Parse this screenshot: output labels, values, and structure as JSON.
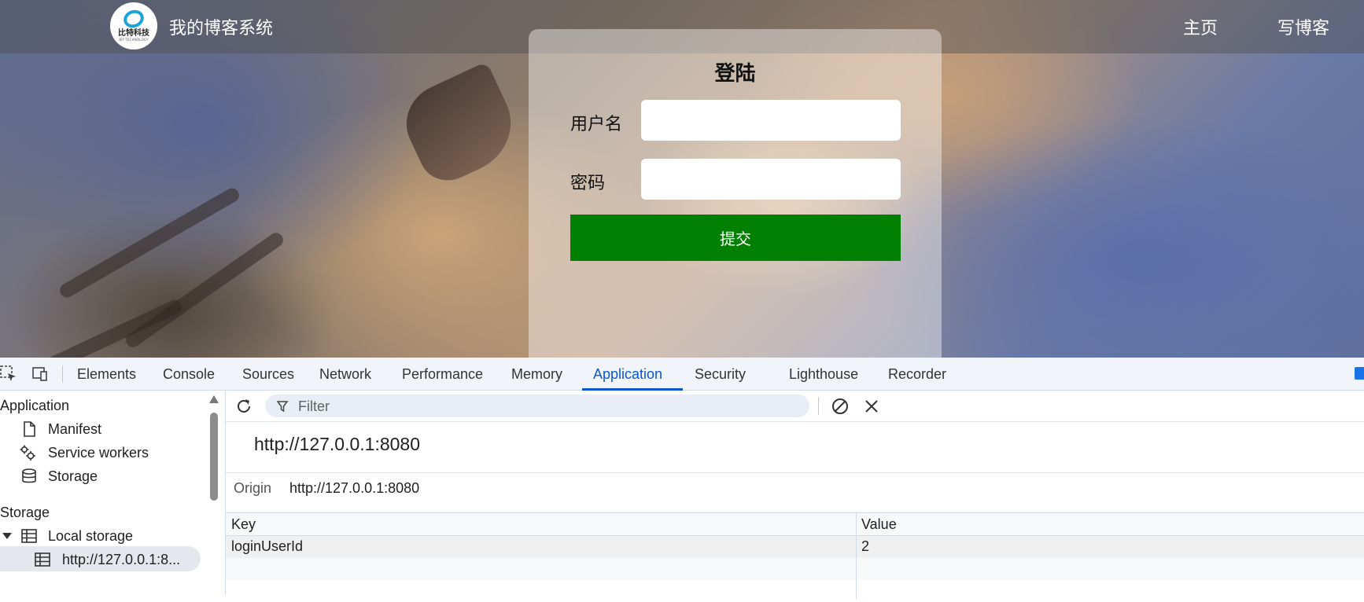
{
  "site": {
    "logo_text": "比特科技",
    "logo_sub": "BIT-TECHNOLOGY",
    "title": "我的博客系统",
    "nav": [
      {
        "label": "主页"
      },
      {
        "label": "写博客"
      }
    ]
  },
  "login": {
    "title": "登陆",
    "username_label": "用户名",
    "username_value": "",
    "password_label": "密码",
    "password_value": "",
    "submit_label": "提交",
    "submit_color": "#008000"
  },
  "devtools": {
    "tabs": [
      {
        "label": "Elements"
      },
      {
        "label": "Console"
      },
      {
        "label": "Sources"
      },
      {
        "label": "Network"
      },
      {
        "label": "Performance"
      },
      {
        "label": "Memory"
      },
      {
        "label": "Application",
        "active": true
      },
      {
        "label": "Security"
      },
      {
        "label": "Lighthouse"
      },
      {
        "label": "Recorder"
      }
    ],
    "accent_color": "#0b57d0",
    "sidebar": {
      "application_heading": "Application",
      "application_items": [
        {
          "label": "Manifest",
          "icon": "file-icon"
        },
        {
          "label": "Service workers",
          "icon": "gears-icon"
        },
        {
          "label": "Storage",
          "icon": "database-icon"
        }
      ],
      "storage_heading": "Storage",
      "local_storage_label": "Local storage",
      "local_storage_child": "http://127.0.0.1:8..."
    },
    "toolbar": {
      "filter_placeholder": "Filter"
    },
    "origin_header": "http://127.0.0.1:8080",
    "origin_label": "Origin",
    "origin_value": "http://127.0.0.1:8080",
    "table": {
      "headers": {
        "key": "Key",
        "value": "Value"
      },
      "rows": [
        {
          "key": "loginUserId",
          "value": "2"
        }
      ]
    }
  }
}
